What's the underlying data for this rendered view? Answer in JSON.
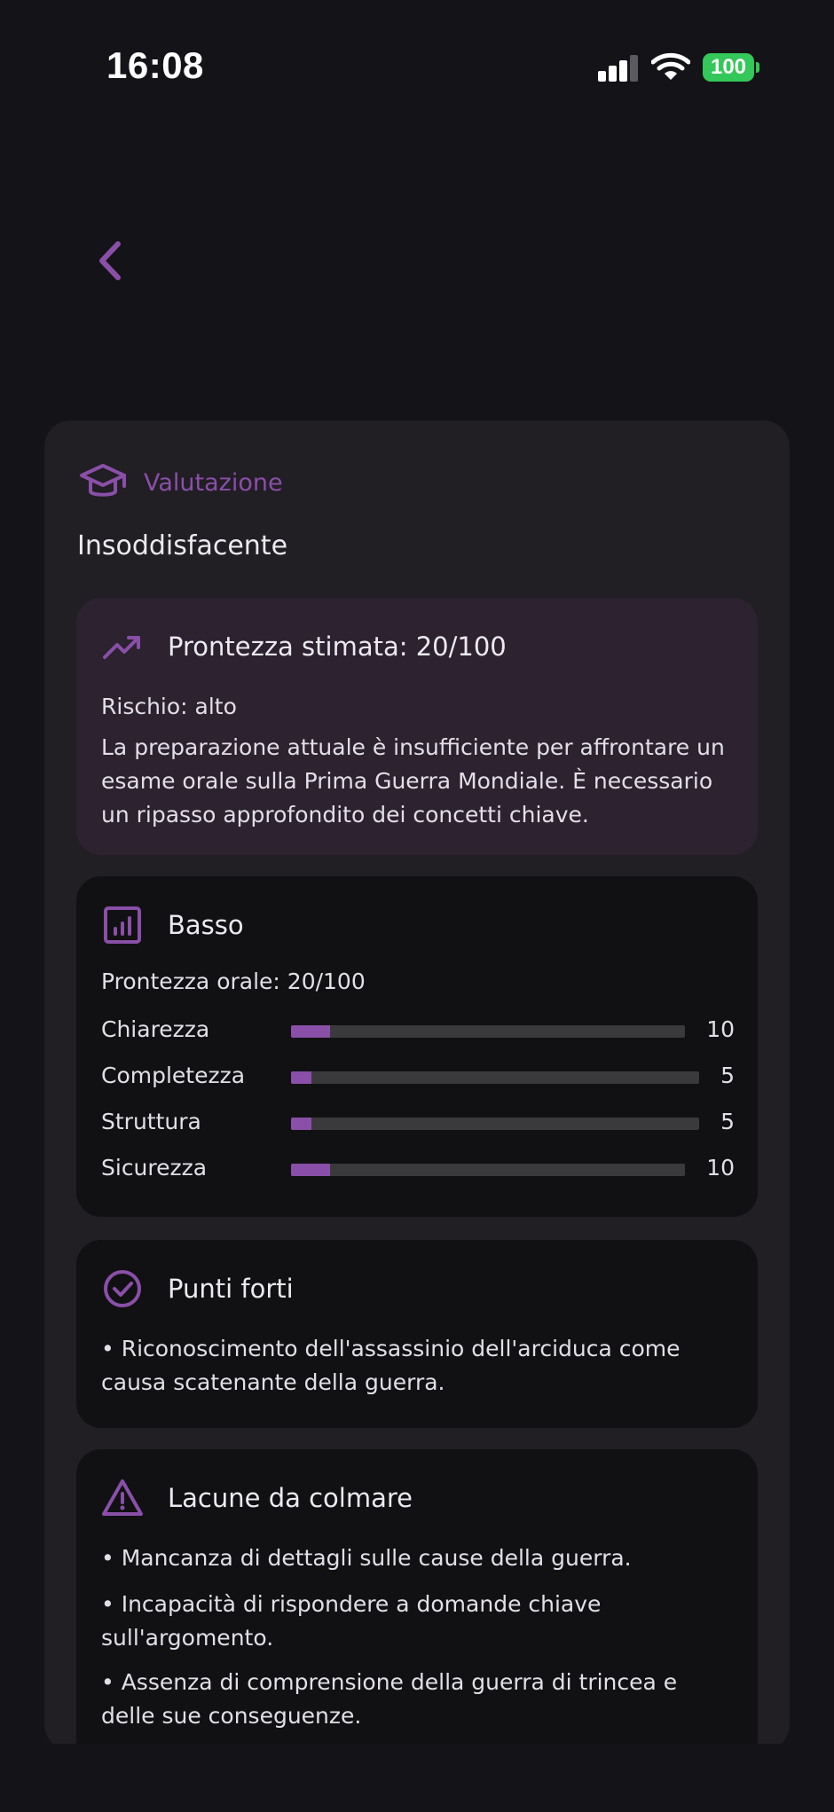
{
  "status_bar": {
    "time": "16:08",
    "battery": "100",
    "icons": [
      "signal-icon",
      "wifi-icon",
      "battery-icon"
    ]
  },
  "navigation": {
    "back_icon": "chevron-left-icon"
  },
  "colors": {
    "background": "#141317",
    "card": "#211E24",
    "accent": "#8A4FA8",
    "highlight_panel": "#2C2230",
    "inner_panel": "#111113",
    "battery": "#34C759"
  },
  "evaluation": {
    "header_icon": "graduation-cap-icon",
    "header_label": "Valutazione",
    "verdict": "Insoddisfacente"
  },
  "readiness": {
    "icon": "trending-up-icon",
    "title": "Prontezza stimata: 20/100",
    "risk": "Rischio: alto",
    "description": "La preparazione attuale è insufficiente per affrontare un esame orale sulla Prima Guerra Mondiale. È necessario un ripasso approfondito dei concetti chiave."
  },
  "scores": {
    "icon": "bar-chart-icon",
    "title": "Basso",
    "oral_readiness": "Prontezza orale: 20/100",
    "items": [
      {
        "label": "Chiarezza",
        "value": "10",
        "fraction": 0.1
      },
      {
        "label": "Completezza",
        "value": "5",
        "fraction": 0.05
      },
      {
        "label": "Struttura",
        "value": "5",
        "fraction": 0.05
      },
      {
        "label": "Sicurezza",
        "value": "10",
        "fraction": 0.1
      }
    ]
  },
  "strengths": {
    "icon": "check-circle-icon",
    "title": "Punti forti",
    "items": [
      "• Riconoscimento dell'assassinio dell'arciduca come causa scatenante della guerra."
    ]
  },
  "gaps": {
    "icon": "warning-triangle-icon",
    "title": "Lacune da colmare",
    "items": [
      "• Mancanza di dettagli sulle cause della guerra.",
      "• Incapacità di rispondere a domande chiave sull'argomento.",
      "• Assenza di comprensione della guerra di trincea e delle sue conseguenze."
    ]
  }
}
